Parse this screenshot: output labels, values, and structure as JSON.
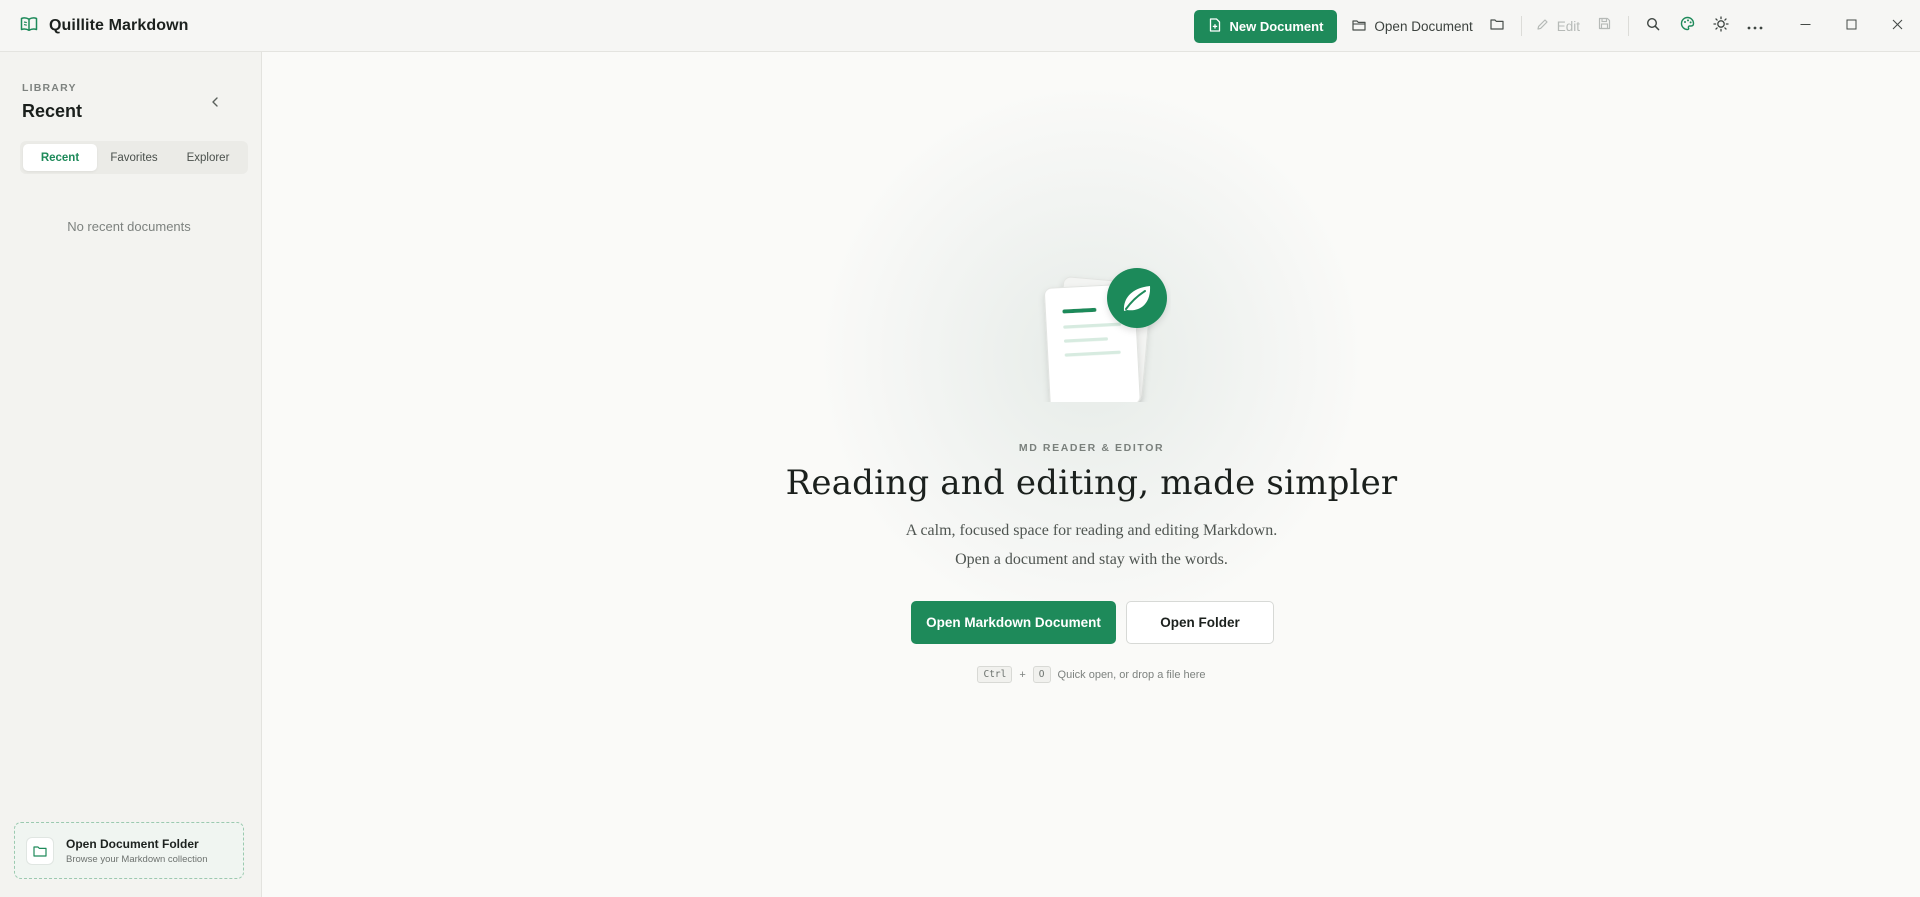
{
  "app": {
    "title": "Quillite Markdown",
    "accent_color": "#1e8a5a"
  },
  "toolbar": {
    "new_document": "New Document",
    "open_document": "Open Document",
    "edit": "Edit",
    "icons": [
      "file-plus-icon",
      "folder-icon",
      "folder-icon",
      "pencil-icon",
      "save-icon",
      "search-icon",
      "palette-icon",
      "sun-icon",
      "more-icon"
    ],
    "window_controls": [
      "minimize-icon",
      "maximize-icon",
      "close-icon"
    ]
  },
  "sidebar": {
    "eyebrow": "LIBRARY",
    "title": "Recent",
    "tabs": [
      {
        "label": "Recent",
        "active": true
      },
      {
        "label": "Favorites",
        "active": false
      },
      {
        "label": "Explorer",
        "active": false
      }
    ],
    "empty_message": "No recent documents",
    "folder_card": {
      "title": "Open Document Folder",
      "subtitle": "Browse your Markdown collection"
    }
  },
  "welcome": {
    "eyebrow": "MD READER & EDITOR",
    "headline": "Reading and editing, made simpler",
    "subline1": "A calm, focused space for reading and editing Markdown.",
    "subline2": "Open a document and stay with the words.",
    "primary_button": "Open Markdown Document",
    "secondary_button": "Open Folder",
    "shortcut_key1": "Ctrl",
    "shortcut_plus": "+",
    "shortcut_key2": "O",
    "shortcut_hint": "Quick open, or drop a file here"
  }
}
